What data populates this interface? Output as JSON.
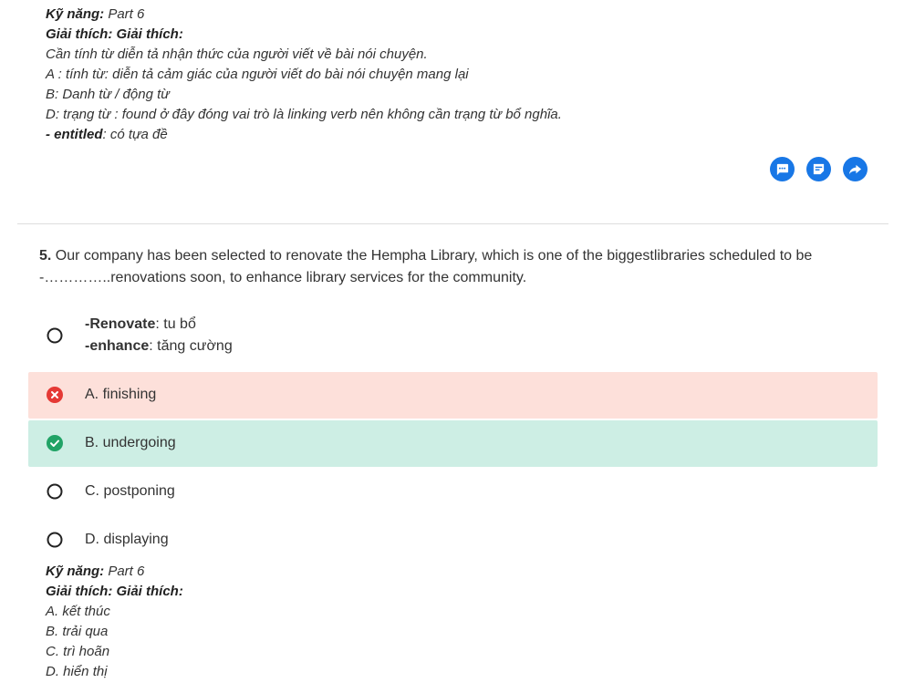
{
  "explanation_top": {
    "skill_label": "Kỹ năng:",
    "skill_value": " Part 6",
    "heading": "Giải thích: Giải thích:",
    "lines": [
      "Cần tính từ diễn tả nhận thức của người viết về bài nói chuyện.",
      "A : tính từ: diễn tả cảm giác của người viết do bài nói chuyện mang lại",
      "B: Danh từ / động từ",
      "D: trạng từ : found ở đây đóng vai trò là linking verb nên không cần trạng từ bổ nghĩa."
    ],
    "vocab_term": "- entitled",
    "vocab_def": ": có tựa đề"
  },
  "actions": [
    {
      "icon": "comment-icon"
    },
    {
      "icon": "note-icon"
    },
    {
      "icon": "share-icon"
    }
  ],
  "question": {
    "number": "5.",
    "text": " Our company has been selected to renovate the Hempha Library, which is one of the biggestlibraries scheduled to be -…………..renovations soon, to enhance library services for the community."
  },
  "hint_option": {
    "term1": "-Renovate",
    "def1": ": tu bổ",
    "term2": "-enhance",
    "def2": ": tăng cường"
  },
  "options": [
    {
      "label": "A. finishing",
      "state": "wrong"
    },
    {
      "label": "B. undergoing",
      "state": "correct"
    },
    {
      "label": "C. postponing",
      "state": "neutral"
    },
    {
      "label": "D. displaying",
      "state": "neutral"
    }
  ],
  "colors": {
    "wrong_bg": "#fde0da",
    "correct_bg": "#cdeee4",
    "wrong_icon": "#e53935",
    "correct_icon": "#21a366",
    "action_blue": "#1877e6"
  },
  "explanation_bottom": {
    "skill_label": "Kỹ năng:",
    "skill_value": " Part 6",
    "heading": "Giải thích: Giải thích:",
    "lines": [
      "A. kết thúc",
      "B. trải qua",
      "C. trì hoãn",
      "D. hiển thị"
    ]
  }
}
